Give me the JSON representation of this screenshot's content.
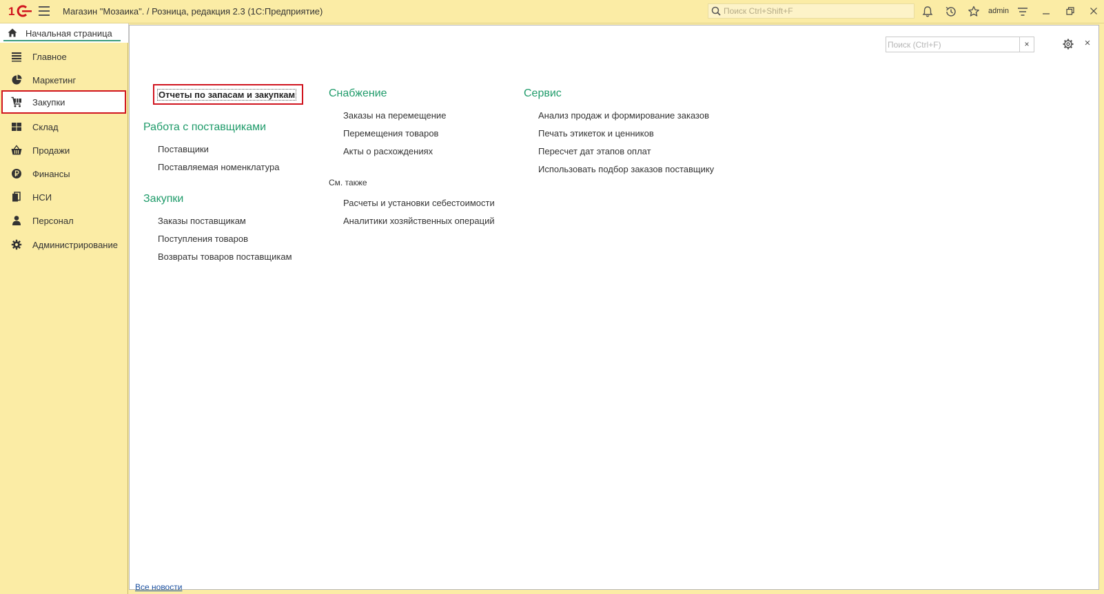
{
  "window": {
    "title": "Магазин \"Мозаика\". / Розница, редакция 2.3  (1С:Предприятие)",
    "search_placeholder": "Поиск Ctrl+Shift+F",
    "user": "admin"
  },
  "home_tab": {
    "label": "Начальная страница"
  },
  "sidebar": {
    "items": [
      {
        "label": "Главное",
        "icon": "list-icon"
      },
      {
        "label": "Маркетинг",
        "icon": "pie-chart-icon"
      },
      {
        "label": "Закупки",
        "icon": "cart-icon",
        "active": true
      },
      {
        "label": "Склад",
        "icon": "grid-icon"
      },
      {
        "label": "Продажи",
        "icon": "basket-icon"
      },
      {
        "label": "Финансы",
        "icon": "ruble-icon"
      },
      {
        "label": "НСИ",
        "icon": "documents-icon"
      },
      {
        "label": "Персонал",
        "icon": "person-icon"
      },
      {
        "label": "Администрирование",
        "icon": "gear-icon"
      }
    ]
  },
  "content": {
    "search_placeholder": "Поиск (Ctrl+F)",
    "clear_label": "×",
    "close_label": "×",
    "featured": "Отчеты по запасам и закупкам",
    "col1": {
      "section1": {
        "title": "Работа с поставщиками",
        "links": [
          "Поставщики",
          "Поставляемая номенклатура"
        ]
      },
      "section2": {
        "title": "Закупки",
        "links": [
          "Заказы поставщикам",
          "Поступления товаров",
          "Возвраты товаров поставщикам"
        ]
      }
    },
    "col2": {
      "section1": {
        "title": "Снабжение",
        "links": [
          "Заказы на перемещение",
          "Перемещения товаров",
          "Акты о расхождениях"
        ]
      },
      "see_also": {
        "title": "См. также",
        "links": [
          "Расчеты и установки себестоимости",
          "Аналитики хозяйственных операций"
        ]
      }
    },
    "col3": {
      "section1": {
        "title": "Сервис",
        "links": [
          "Анализ продаж и формирование заказов",
          "Печать этикеток и ценников",
          "Пересчет дат этапов оплат",
          "Использовать подбор заказов поставщику"
        ]
      }
    }
  },
  "footer": {
    "partial_link": "Все новости"
  },
  "colors": {
    "accent_green": "#1f9b6a",
    "highlight_red": "#d0141e",
    "panel_yellow": "#fbeca5",
    "logo_red": "#d0141e"
  }
}
